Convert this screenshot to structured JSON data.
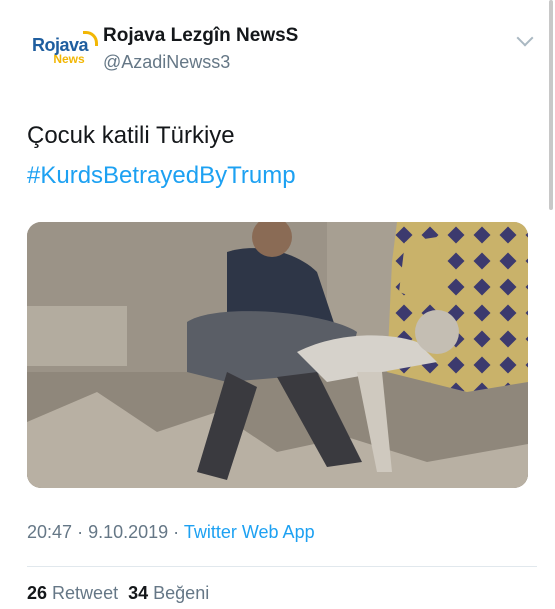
{
  "account": {
    "logo_top": "Rojava",
    "logo_bottom": "News",
    "display_name": "Rojava Lezgîn NewsS",
    "handle": "@AzadiNewss3"
  },
  "tweet": {
    "text": "Çocuk katili Türkiye",
    "hashtag": "#KurdsBetrayedByTrump",
    "time": "20:47",
    "date": "9.10.2019",
    "separator": "·",
    "source": "Twitter Web App"
  },
  "stats": {
    "retweets": "26",
    "retweets_label": "Retweet",
    "likes": "34",
    "likes_label": "Beğeni"
  },
  "colors": {
    "link": "#1da1f2",
    "secondary_text": "#657786",
    "logo_blue": "#1f5e9f",
    "logo_yellow": "#f2b705"
  },
  "icons": [
    "chevron-down-icon"
  ]
}
